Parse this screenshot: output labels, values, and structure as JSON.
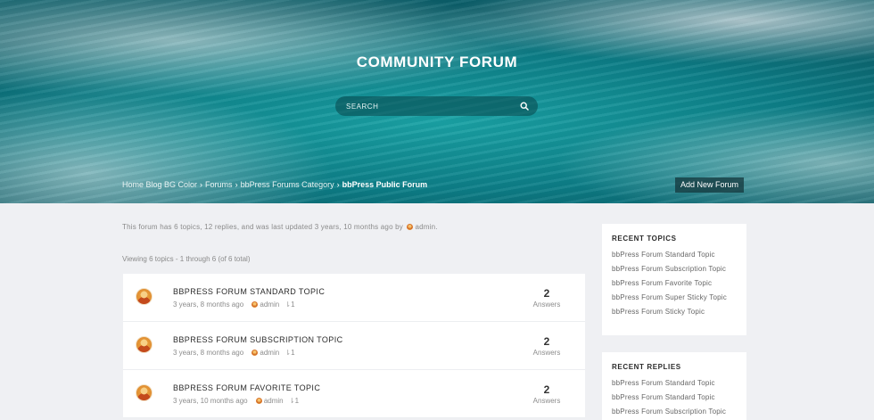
{
  "hero": {
    "title": "COMMUNITY FORUM",
    "search_placeholder": "SEARCH",
    "add_new_forum_label": "Add New Forum"
  },
  "breadcrumb": {
    "items": [
      "Home Blog BG Color",
      "Forums",
      "bbPress Forums Category"
    ],
    "separator": "›",
    "current": "bbPress Public Forum"
  },
  "forum_info": {
    "text": "This forum has 6 topics, 12 replies, and was last updated 3 years, 10 months ago by",
    "author": "admin."
  },
  "viewing": "Viewing 6 topics - 1 through 6 (of 6 total)",
  "topics": [
    {
      "title": "BBPRESS FORUM STANDARD TOPIC",
      "time": "3 years, 8 months ago",
      "author": "admin",
      "votes": "1",
      "answers": "2",
      "answers_label": "Answers"
    },
    {
      "title": "BBPRESS FORUM SUBSCRIPTION TOPIC",
      "time": "3 years, 8 months ago",
      "author": "admin",
      "votes": "1",
      "answers": "2",
      "answers_label": "Answers"
    },
    {
      "title": "BBPRESS FORUM FAVORITE TOPIC",
      "time": "3 years, 10 months ago",
      "author": "admin",
      "votes": "1",
      "answers": "2",
      "answers_label": "Answers"
    }
  ],
  "recent_topics": {
    "title": "RECENT TOPICS",
    "items": [
      "bbPress Forum Standard Topic",
      "bbPress Forum Subscription Topic",
      "bbPress Forum Favorite Topic",
      "bbPress Forum Super Sticky Topic",
      "bbPress Forum Sticky Topic"
    ]
  },
  "recent_replies": {
    "title": "RECENT REPLIES",
    "items": [
      "bbPress Forum Standard Topic",
      "bbPress Forum Standard Topic",
      "bbPress Forum Subscription Topic"
    ]
  },
  "icons": {
    "search": "search-icon",
    "vote": "thumb-icon",
    "avatar": "avatar"
  }
}
